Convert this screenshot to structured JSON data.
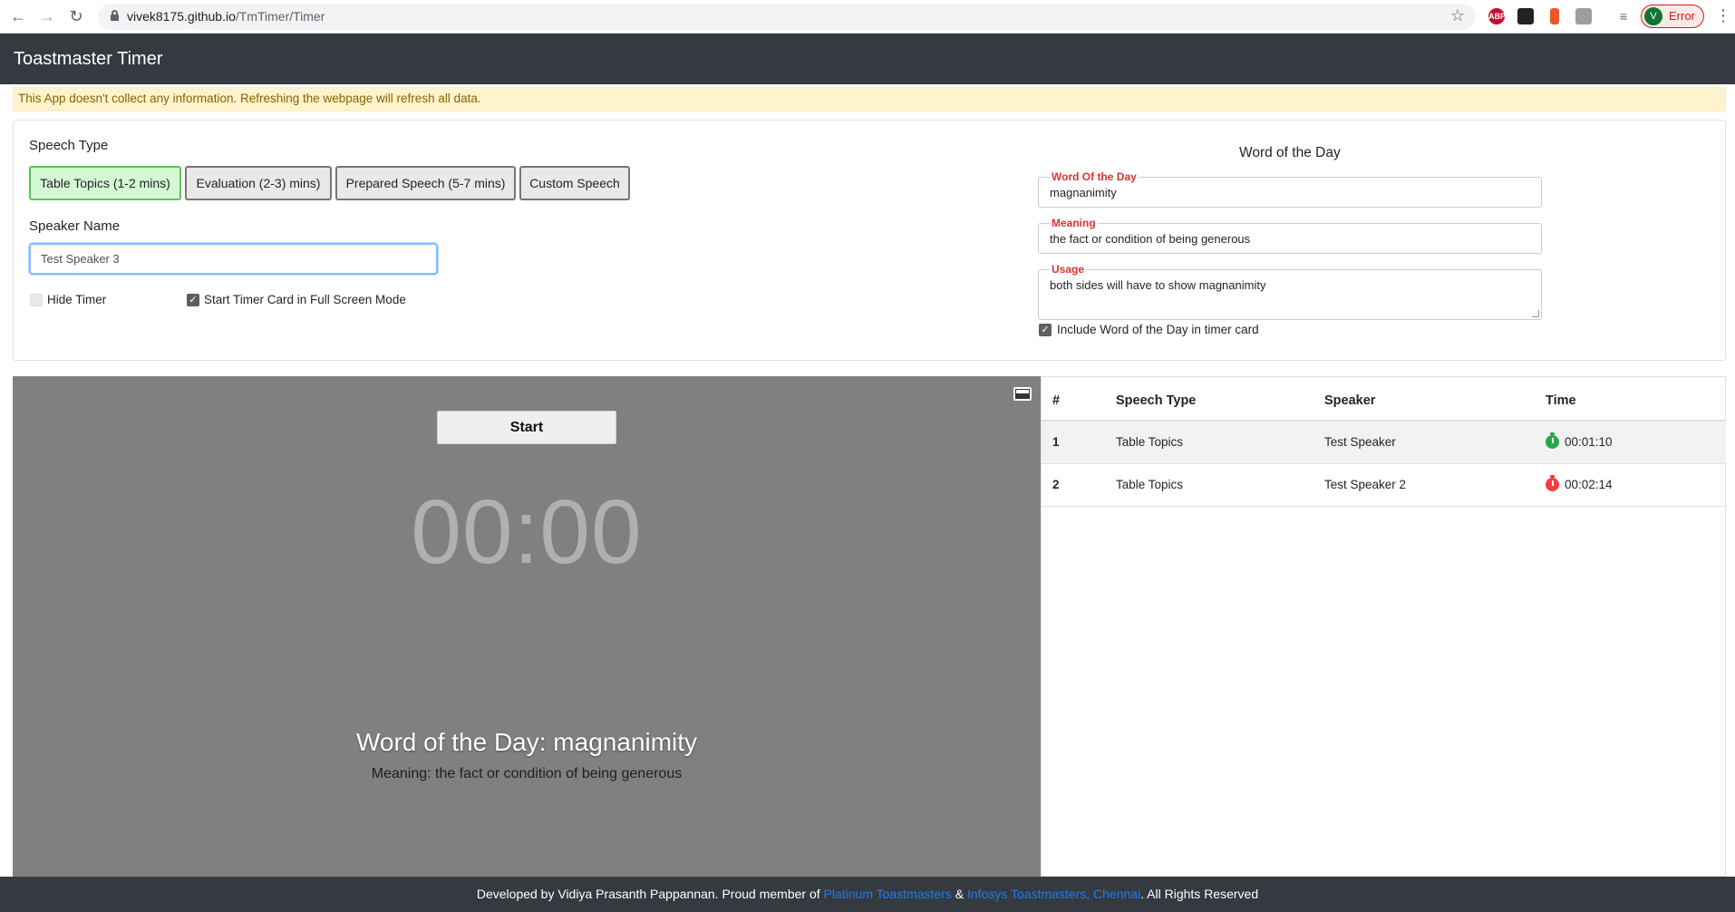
{
  "browser": {
    "url_host": "vivek8175.github.io",
    "url_path": "/TmTimer/Timer",
    "profile_initial": "V",
    "profile_status": "Error",
    "extensions": [
      {
        "name": "adblock-plus-icon",
        "label": "ABP",
        "color": "#c70d2c"
      },
      {
        "name": "extension-icon",
        "label": "",
        "color": "#222222"
      },
      {
        "name": "extension-icon-2",
        "label": "",
        "color": "#e8572a"
      },
      {
        "name": "pdf-icon",
        "label": "",
        "color": "#9e9e9e"
      }
    ]
  },
  "app": {
    "brand": "Toastmaster Timer",
    "notice": "This App doesn't collect any information. Refreshing the webpage will refresh all data."
  },
  "settings": {
    "speech_type_label": "Speech Type",
    "speech_types": [
      {
        "label": "Table Topics (1-2 mins)",
        "active": true
      },
      {
        "label": "Evaluation (2-3) mins)",
        "active": false
      },
      {
        "label": "Prepared Speech (5-7 mins)",
        "active": false
      },
      {
        "label": "Custom Speech",
        "active": false
      }
    ],
    "speaker_name_label": "Speaker Name",
    "speaker_name_value": "Test Speaker 3",
    "hide_timer_label": "Hide Timer",
    "hide_timer_checked": false,
    "fullscreen_label": "Start Timer Card in Full Screen Mode",
    "fullscreen_checked": true
  },
  "word_of_day": {
    "section_title": "Word of the Day",
    "word_legend": "Word Of the Day",
    "word_value": "magnanimity",
    "meaning_legend": "Meaning",
    "meaning_value": "the fact or condition of being generous",
    "usage_legend": "Usage",
    "usage_value": "both sides will have to show magnanimity",
    "include_label": "Include Word of the Day in timer card",
    "include_checked": true
  },
  "timer_card": {
    "start_label": "Start",
    "time_display": "00:00",
    "wotd_display": "Word of the Day: magnanimity",
    "meaning_display": "Meaning: the fact or condition of being generous"
  },
  "history": {
    "columns": [
      "#",
      "Speech Type",
      "Speaker",
      "Time"
    ],
    "rows": [
      {
        "num": "1",
        "speech_type": "Table Topics",
        "speaker": "Test Speaker",
        "time": "00:01:10",
        "status_color": "#28a745"
      },
      {
        "num": "2",
        "speech_type": "Table Topics",
        "speaker": "Test Speaker 2",
        "time": "00:02:14",
        "status_color": "#f03e3e"
      }
    ]
  },
  "footer": {
    "prefix": "Developed by Vidiya Prasanth Pappannan. Proud member of ",
    "link1": "Platinum Toastmasters",
    "amp": " & ",
    "link2": "Infosys Toastmasters, Chennai",
    "suffix": ". All Rights Reserved"
  }
}
